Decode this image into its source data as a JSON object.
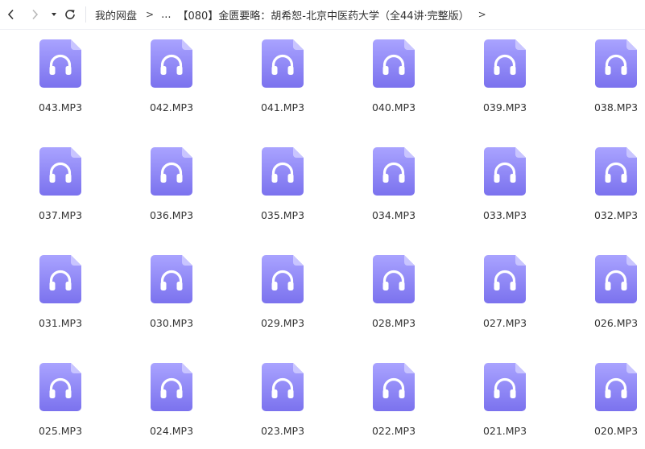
{
  "toolbar": {
    "back_icon": "chevron-left-icon",
    "forward_icon": "chevron-right-icon",
    "history_icon": "caret-down-icon",
    "refresh_icon": "refresh-icon"
  },
  "breadcrumb": {
    "root": "我的网盘",
    "ellipsis": "...",
    "current": "【080】金匮要略：胡希恕-北京中医药大学（全44讲·完整版）",
    "separator": ">"
  },
  "colors": {
    "icon_light": "#a9a3ff",
    "icon_dark": "#7b72ee",
    "icon_fold": "#c9c5ff"
  },
  "files": [
    {
      "name": "043.MP3",
      "icon": "audio-file-icon"
    },
    {
      "name": "042.MP3",
      "icon": "audio-file-icon"
    },
    {
      "name": "041.MP3",
      "icon": "audio-file-icon"
    },
    {
      "name": "040.MP3",
      "icon": "audio-file-icon"
    },
    {
      "name": "039.MP3",
      "icon": "audio-file-icon"
    },
    {
      "name": "038.MP3",
      "icon": "audio-file-icon"
    },
    {
      "name": "037.MP3",
      "icon": "audio-file-icon"
    },
    {
      "name": "036.MP3",
      "icon": "audio-file-icon"
    },
    {
      "name": "035.MP3",
      "icon": "audio-file-icon"
    },
    {
      "name": "034.MP3",
      "icon": "audio-file-icon"
    },
    {
      "name": "033.MP3",
      "icon": "audio-file-icon"
    },
    {
      "name": "032.MP3",
      "icon": "audio-file-icon"
    },
    {
      "name": "031.MP3",
      "icon": "audio-file-icon"
    },
    {
      "name": "030.MP3",
      "icon": "audio-file-icon"
    },
    {
      "name": "029.MP3",
      "icon": "audio-file-icon"
    },
    {
      "name": "028.MP3",
      "icon": "audio-file-icon"
    },
    {
      "name": "027.MP3",
      "icon": "audio-file-icon"
    },
    {
      "name": "026.MP3",
      "icon": "audio-file-icon"
    },
    {
      "name": "025.MP3",
      "icon": "audio-file-icon"
    },
    {
      "name": "024.MP3",
      "icon": "audio-file-icon"
    },
    {
      "name": "023.MP3",
      "icon": "audio-file-icon"
    },
    {
      "name": "022.MP3",
      "icon": "audio-file-icon"
    },
    {
      "name": "021.MP3",
      "icon": "audio-file-icon"
    },
    {
      "name": "020.MP3",
      "icon": "audio-file-icon"
    }
  ]
}
